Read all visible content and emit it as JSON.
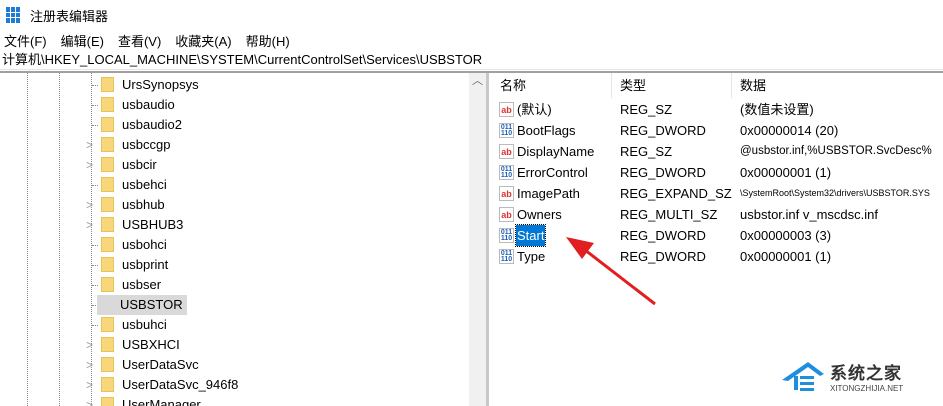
{
  "window": {
    "title": "注册表编辑器"
  },
  "menu": [
    "文件(F)",
    "编辑(E)",
    "查看(V)",
    "收藏夹(A)",
    "帮助(H)"
  ],
  "address": "计算机\\HKEY_LOCAL_MACHINE\\SYSTEM\\CurrentControlSet\\Services\\USBSTOR",
  "tree": [
    {
      "label": "UrsSynopsys",
      "expandable": false
    },
    {
      "label": "usbaudio",
      "expandable": false
    },
    {
      "label": "usbaudio2",
      "expandable": false
    },
    {
      "label": "usbccgp",
      "expandable": true
    },
    {
      "label": "usbcir",
      "expandable": true
    },
    {
      "label": "usbehci",
      "expandable": false
    },
    {
      "label": "usbhub",
      "expandable": true
    },
    {
      "label": "USBHUB3",
      "expandable": true
    },
    {
      "label": "usbohci",
      "expandable": false
    },
    {
      "label": "usbprint",
      "expandable": false
    },
    {
      "label": "usbser",
      "expandable": false
    },
    {
      "label": "USBSTOR",
      "expandable": false,
      "selected": true
    },
    {
      "label": "usbuhci",
      "expandable": false
    },
    {
      "label": "USBXHCI",
      "expandable": true
    },
    {
      "label": "UserDataSvc",
      "expandable": true
    },
    {
      "label": "UserDataSvc_946f8",
      "expandable": true
    },
    {
      "label": "UserManager",
      "expandable": true
    }
  ],
  "list": {
    "headers": {
      "name": "名称",
      "type": "类型",
      "data": "数据"
    },
    "rows": [
      {
        "icon": "ab",
        "name": "(默认)",
        "type": "REG_SZ",
        "data": "(数值未设置)"
      },
      {
        "icon": "dword",
        "name": "BootFlags",
        "type": "REG_DWORD",
        "data": "0x00000014 (20)"
      },
      {
        "icon": "ab",
        "name": "DisplayName",
        "type": "REG_SZ",
        "data": "@usbstor.inf,%USBSTOR.SvcDesc%"
      },
      {
        "icon": "dword",
        "name": "ErrorControl",
        "type": "REG_DWORD",
        "data": "0x00000001 (1)"
      },
      {
        "icon": "ab",
        "name": "ImagePath",
        "type": "REG_EXPAND_SZ",
        "data": "\\SystemRoot\\System32\\drivers\\USBSTOR.SYS"
      },
      {
        "icon": "ab",
        "name": "Owners",
        "type": "REG_MULTI_SZ",
        "data": "usbstor.inf v_mscdsc.inf"
      },
      {
        "icon": "dword",
        "name": "Start",
        "type": "REG_DWORD",
        "data": "0x00000003 (3)",
        "selected": true
      },
      {
        "icon": "dword",
        "name": "Type",
        "type": "REG_DWORD",
        "data": "0x00000001 (1)"
      }
    ]
  },
  "watermark": {
    "cn": "系统之家",
    "en": "XITONGZHIJIA.NET"
  },
  "colors": {
    "selection": "#0078d7",
    "arrow": "#e02020"
  }
}
